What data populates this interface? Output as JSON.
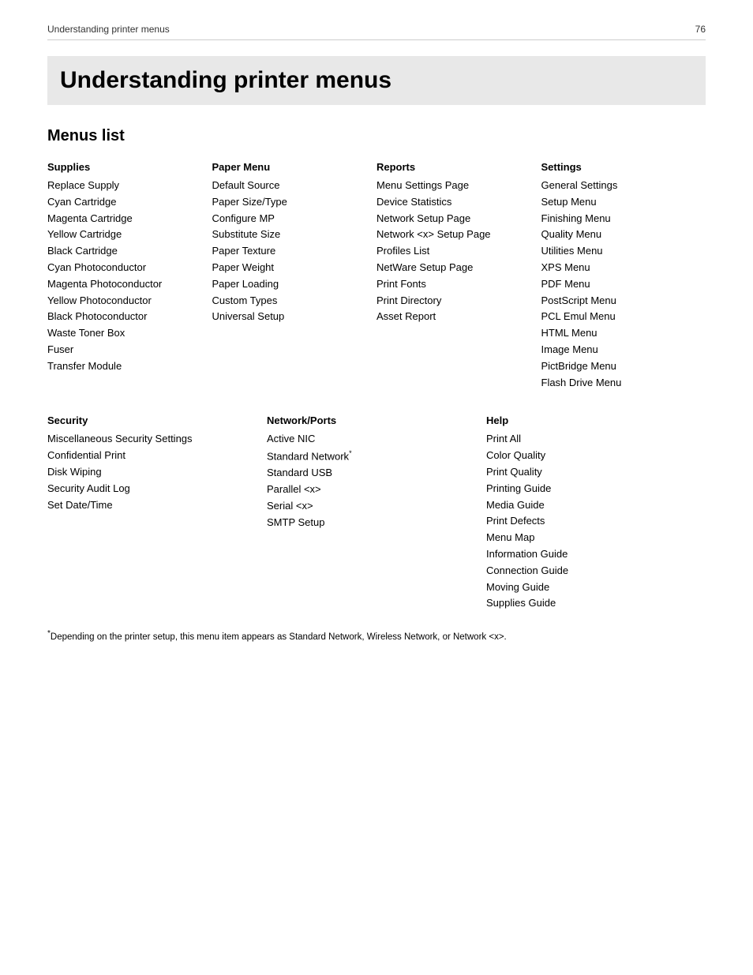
{
  "header": {
    "title": "Understanding printer menus",
    "page_number": "76"
  },
  "section_title": "Understanding printer menus",
  "menus_list_title": "Menus list",
  "columns_row1": [
    {
      "header": "Supplies",
      "items": [
        "Replace Supply",
        "Cyan Cartridge",
        "Magenta Cartridge",
        "Yellow Cartridge",
        "Black Cartridge",
        "Cyan Photoconductor",
        "Magenta Photoconductor",
        "Yellow Photoconductor",
        "Black Photoconductor",
        "Waste Toner Box",
        "Fuser",
        "Transfer Module"
      ]
    },
    {
      "header": "Paper Menu",
      "items": [
        "Default Source",
        "Paper Size/Type",
        "Configure MP",
        "Substitute Size",
        "Paper Texture",
        "Paper Weight",
        "Paper Loading",
        "Custom Types",
        "Universal Setup"
      ]
    },
    {
      "header": "Reports",
      "items": [
        "Menu Settings Page",
        "Device Statistics",
        "Network Setup Page",
        "Network <x> Setup Page",
        "Profiles List",
        "NetWare Setup Page",
        "Print Fonts",
        "Print Directory",
        "Asset Report"
      ]
    },
    {
      "header": "Settings",
      "items": [
        "General Settings",
        "Setup Menu",
        "Finishing Menu",
        "Quality Menu",
        "Utilities Menu",
        "XPS Menu",
        "PDF Menu",
        "PostScript Menu",
        "PCL Emul Menu",
        "HTML Menu",
        "Image Menu",
        "PictBridge Menu",
        "Flash Drive Menu"
      ]
    }
  ],
  "columns_row2": [
    {
      "header": "Security",
      "items": [
        "Miscellaneous Security Settings",
        "Confidential Print",
        "Disk Wiping",
        "Security Audit Log",
        "Set Date/Time"
      ]
    },
    {
      "header": "Network/Ports",
      "items": [
        "Active NIC",
        "Standard Network*",
        "Standard USB",
        "Parallel <x>",
        "Serial <x>",
        "SMTP Setup"
      ]
    },
    {
      "header": "Help",
      "items": [
        "Print All",
        "Color Quality",
        "Print Quality",
        "Printing Guide",
        "Media Guide",
        "Print Defects",
        "Menu Map",
        "Information Guide",
        "Connection Guide",
        "Moving Guide",
        "Supplies Guide"
      ]
    }
  ],
  "footnote": "*Depending on the printer setup, this menu item appears as Standard Network, Wireless Network, or Network <x>.",
  "network_standard_asterisk": "Standard Network*"
}
